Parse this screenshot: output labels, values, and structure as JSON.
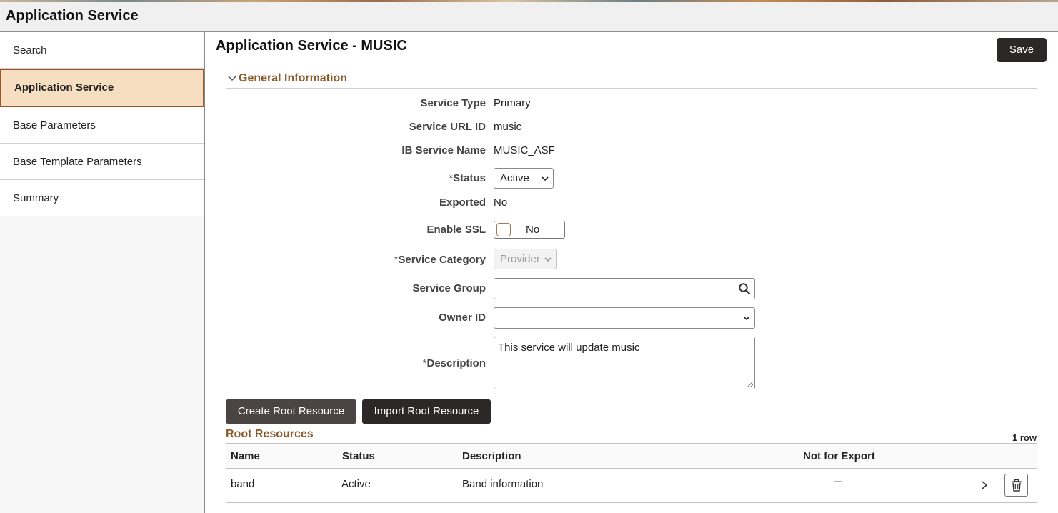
{
  "app": {
    "title": "Application Service"
  },
  "sidebar": {
    "items": [
      {
        "label": "Search"
      },
      {
        "label": "Application Service"
      },
      {
        "label": "Base Parameters"
      },
      {
        "label": "Base Template Parameters"
      },
      {
        "label": "Summary"
      }
    ]
  },
  "page": {
    "title": "Application Service - MUSIC",
    "save_label": "Save"
  },
  "general": {
    "section_label": "General Information",
    "fields": {
      "service_type": {
        "label": "Service Type",
        "value": "Primary"
      },
      "service_url_id": {
        "label": "Service URL ID",
        "value": "music"
      },
      "ib_service_name": {
        "label": "IB Service Name",
        "value": "MUSIC_ASF"
      },
      "status": {
        "label": "Status",
        "required_mark": "*",
        "value": "Active"
      },
      "exported": {
        "label": "Exported",
        "value": "No"
      },
      "enable_ssl": {
        "label": "Enable SSL",
        "value": "No"
      },
      "service_category": {
        "label": "Service Category",
        "required_mark": "*",
        "value": "Provider"
      },
      "service_group": {
        "label": "Service Group",
        "value": ""
      },
      "owner_id": {
        "label": "Owner ID",
        "value": ""
      },
      "description": {
        "label": "Description",
        "required_mark": "*",
        "value": "This service will update music"
      }
    }
  },
  "buttons": {
    "create_root": "Create Root Resource",
    "import_root": "Import Root Resource"
  },
  "root_resources": {
    "title": "Root Resources",
    "row_count": "1 row",
    "columns": [
      "Name",
      "Status",
      "Description",
      "Not for Export"
    ],
    "rows": [
      {
        "name": "band",
        "status": "Active",
        "description": "Band information",
        "not_for_export": false
      }
    ]
  },
  "colors": {
    "accent_brown": "#8b5a2b",
    "active_bg": "#f6dfc0",
    "dark_button": "#2b2827"
  }
}
